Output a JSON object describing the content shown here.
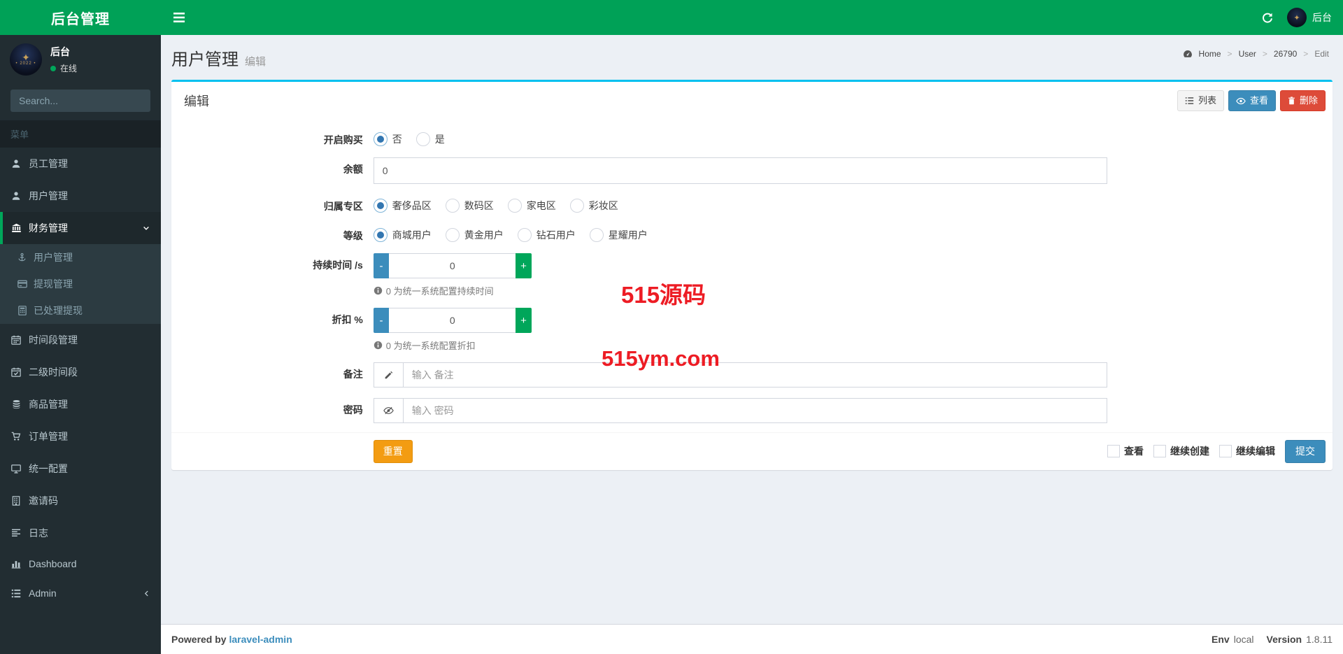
{
  "app": {
    "logo": "后台管理",
    "topbar_user": "后台"
  },
  "sidebar": {
    "user_name": "后台",
    "user_status": "在线",
    "search_placeholder": "Search...",
    "section_label": "菜单",
    "items": [
      {
        "label": "员工管理"
      },
      {
        "label": "用户管理"
      },
      {
        "label": "财务管理",
        "active": true,
        "children": [
          {
            "label": "用户管理"
          },
          {
            "label": "提现管理"
          },
          {
            "label": "已处理提现"
          }
        ]
      },
      {
        "label": "时间段管理"
      },
      {
        "label": "二级时间段"
      },
      {
        "label": "商品管理"
      },
      {
        "label": "订单管理"
      },
      {
        "label": "统一配置"
      },
      {
        "label": "邀请码"
      },
      {
        "label": "日志"
      },
      {
        "label": "Dashboard"
      },
      {
        "label": "Admin"
      }
    ]
  },
  "header": {
    "title": "用户管理",
    "subtitle": "编辑",
    "breadcrumb": {
      "home": "Home",
      "user": "User",
      "id": "26790",
      "current": "Edit"
    }
  },
  "card": {
    "title": "编辑",
    "list_button": "列表",
    "view_button": "查看",
    "delete_button": "删除"
  },
  "form": {
    "purchase": {
      "label": "开启购买",
      "options": [
        "否",
        "是"
      ],
      "selected": "否"
    },
    "balance": {
      "label": "余额",
      "value": "0"
    },
    "zone": {
      "label": "归属专区",
      "options": [
        "奢侈品区",
        "数码区",
        "家电区",
        "彩妆区"
      ],
      "selected": "奢侈品区"
    },
    "level": {
      "label": "等级",
      "options": [
        "商城用户",
        "黄金用户",
        "钻石用户",
        "星耀用户"
      ],
      "selected": "商城用户"
    },
    "duration": {
      "label": "持续时间 /s",
      "value": "0",
      "minus": "-",
      "plus": "+",
      "help": "0 为统一系统配置持续时间"
    },
    "discount": {
      "label": "折扣 %",
      "value": "0",
      "minus": "-",
      "plus": "+",
      "help": "0 为统一系统配置折扣"
    },
    "remark": {
      "label": "备注",
      "placeholder": "输入 备注"
    },
    "password": {
      "label": "密码",
      "placeholder": "输入 密码"
    },
    "footer": {
      "reset": "重置",
      "view_checkbox": "查看",
      "continue_creating_checkbox": "继续创建",
      "continue_editing_checkbox": "继续编辑",
      "submit": "提交"
    }
  },
  "watermark": {
    "line1": "515源码",
    "line2": "515ym.com"
  },
  "footer": {
    "powered_by": "Powered by",
    "framework": "laravel-admin",
    "env_label": "Env",
    "env_value": "local",
    "version_label": "Version",
    "version_value": "1.8.11"
  },
  "colors": {
    "brand_green": "#00a157",
    "info_cyan": "#00c0ef",
    "primary_blue": "#3c8dbc",
    "danger_red": "#dd4b39",
    "warning_orange": "#f39c12",
    "watermark_red": "#ed1c24"
  }
}
